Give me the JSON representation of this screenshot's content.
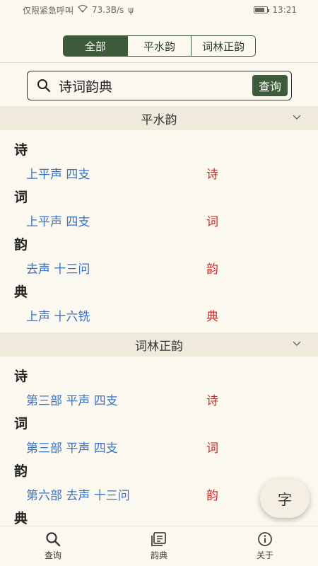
{
  "status_bar": {
    "carrier": "仅限紧急呼叫",
    "speed": "73.3B/s",
    "usb": "ψ",
    "time": "13:21"
  },
  "tabs": [
    {
      "label": "全部",
      "active": true
    },
    {
      "label": "平水韵",
      "active": false
    },
    {
      "label": "词林正韵",
      "active": false
    }
  ],
  "search": {
    "value": "诗词韵典",
    "button_label": "查询"
  },
  "sections": [
    {
      "title": "平水韵",
      "entries": [
        {
          "char": "诗",
          "rhyme": "上平声 四支",
          "rhyme_char": "诗"
        },
        {
          "char": "词",
          "rhyme": "上平声 四支",
          "rhyme_char": "词"
        },
        {
          "char": "韵",
          "rhyme": "去声 十三问",
          "rhyme_char": "韵"
        },
        {
          "char": "典",
          "rhyme": "上声 十六铣",
          "rhyme_char": "典"
        }
      ]
    },
    {
      "title": "词林正韵",
      "entries": [
        {
          "char": "诗",
          "rhyme": "第三部 平声 四支",
          "rhyme_char": "诗"
        },
        {
          "char": "词",
          "rhyme": "第三部 平声 四支",
          "rhyme_char": "词"
        },
        {
          "char": "韵",
          "rhyme": "第六部 去声 十三问",
          "rhyme_char": "韵"
        },
        {
          "char": "典",
          "rhyme": "",
          "rhyme_char": ""
        }
      ]
    }
  ],
  "fab_label": "字",
  "bottom_nav": [
    {
      "label": "查询",
      "icon": "search-icon"
    },
    {
      "label": "韵典",
      "icon": "book-icon"
    },
    {
      "label": "关于",
      "icon": "info-icon"
    }
  ],
  "colors": {
    "accent": "#3d5a3a",
    "rhyme_text": "#3a72c4",
    "char_red": "#cc2a2a",
    "background": "#fbf8ef",
    "section_bg": "#efeadc"
  }
}
